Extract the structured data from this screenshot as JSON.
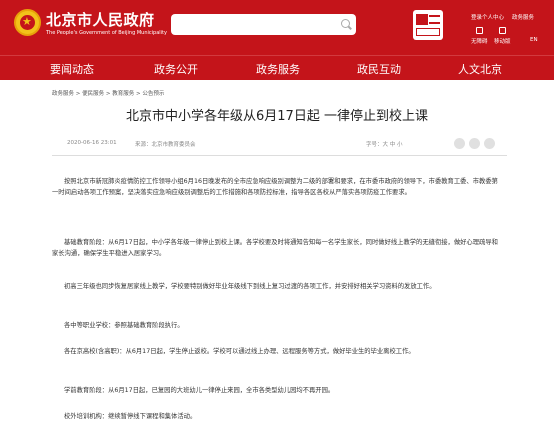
{
  "header": {
    "title": "北京市人民政府",
    "subtitle": "The People's Government of Beijing Municipality",
    "links": {
      "login": "登录个人中心",
      "entry": "政务服务",
      "nav1": "无障碍",
      "nav2": "移动版",
      "lang": "EN"
    }
  },
  "nav": {
    "items": [
      "要闻动态",
      "政务公开",
      "政务服务",
      "政民互动",
      "人文北京"
    ]
  },
  "breadcrumb": "政务服务 > 便民服务 > 教育服务 > 公告预示",
  "article": {
    "title": "北京市中小学各年级从6月17日起 一律停止到校上课",
    "date": "2020-06-16 23:01",
    "source": "来源：北京市教育委员会",
    "font_size": "字号：大 中 小",
    "paragraphs": [
      "按照北京市新冠肺炎疫情防控工作领导小组6月16日晚发布的全市应急响应级别调整为二级的部署和要求，在市委市政府的领导下，市委教育工委、市教委第一时间启动各项工作预案，坚决落实应急响应级别调整后的工作措施和各项防控标准，指导各区各校从严落实各项防疫工作要求。",
      "基础教育阶段：从6月17日起，中小学各年级一律停止到校上课。各学校要及时将通知告知每一名学生家长，同时做好线上教学的无缝衔接，做好心理疏导和家长沟通，确保学生平稳进入居家学习。",
      "初高三年级也同步恢复居家线上教学，学校要特别做好毕业年级线下到线上复习过渡的各项工作，并安排好相关学习资料的发放工作。",
      "各中等职业学校：参照基础教育阶段执行。",
      "各在京高校(含高职)：从6月17日起，学生停止返校。学校可以通过线上办理、远程服务等方式，做好毕业生的毕业离校工作。",
      "学前教育阶段：从6月17日起，已复园的大班幼儿一律停止来园，全市各类型幼儿园均不再开园。",
      "校外培训机构：继续暂停线下课程和集体活动。"
    ]
  }
}
